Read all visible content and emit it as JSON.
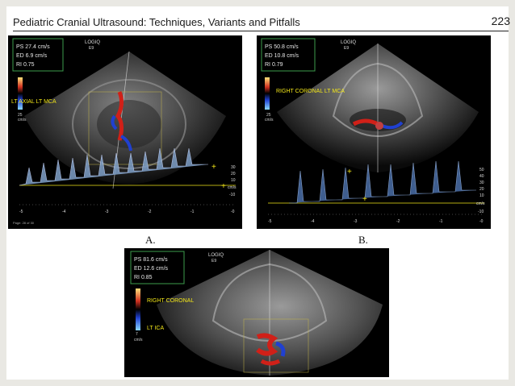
{
  "header": {
    "title": "Pediatric Cranial Ultrasound: Techniques, Variants and Pitfalls",
    "page_number": "223"
  },
  "figures": [
    {
      "label": "A.",
      "logo": "LOGIQ",
      "logo_model": "E9",
      "measure": [
        "PS 27.4 cm/s",
        "ED  6.9 cm/s",
        "RI       0.75"
      ],
      "view_label": "LT AXIAL LT MCA",
      "scale_unit": "cm/s",
      "scale_top": "25",
      "doppler_ticks": [
        "30",
        "20",
        "10",
        "cm/s",
        "-10"
      ],
      "time_ticks": [
        "-5",
        "-4",
        "-3",
        "-2",
        "-1",
        "-0"
      ],
      "footer_note": "Page: 28 of 30"
    },
    {
      "label": "B.",
      "logo": "LOGIQ",
      "logo_model": "E9",
      "measure": [
        "PS 50.8 cm/s",
        "ED 10.8 cm/s",
        "RI       0.79"
      ],
      "view_label": "RIGHT CORONAL LT MCA",
      "scale_unit": "cm/s",
      "scale_top": "25",
      "doppler_ticks": [
        "50",
        "40",
        "30",
        "20",
        "10",
        "cm/s",
        "-10"
      ],
      "time_ticks": [
        "-5",
        "-4",
        "-3",
        "-2",
        "-1",
        "-0"
      ]
    },
    {
      "label": "",
      "logo": "LOGIQ",
      "logo_model": "E9",
      "measure": [
        "PS 81.6 cm/s",
        "ED 12.6 cm/s",
        "RI       0.85"
      ],
      "view_label": "RIGHT CORONAL",
      "view_label_2": "LT ICA",
      "scale_unit": "cm/s",
      "scale_top": "7"
    }
  ],
  "colors": {
    "overlay_text": "#f2e619",
    "measure_text": "#e8e8e8",
    "background": "#e9e8e3"
  }
}
